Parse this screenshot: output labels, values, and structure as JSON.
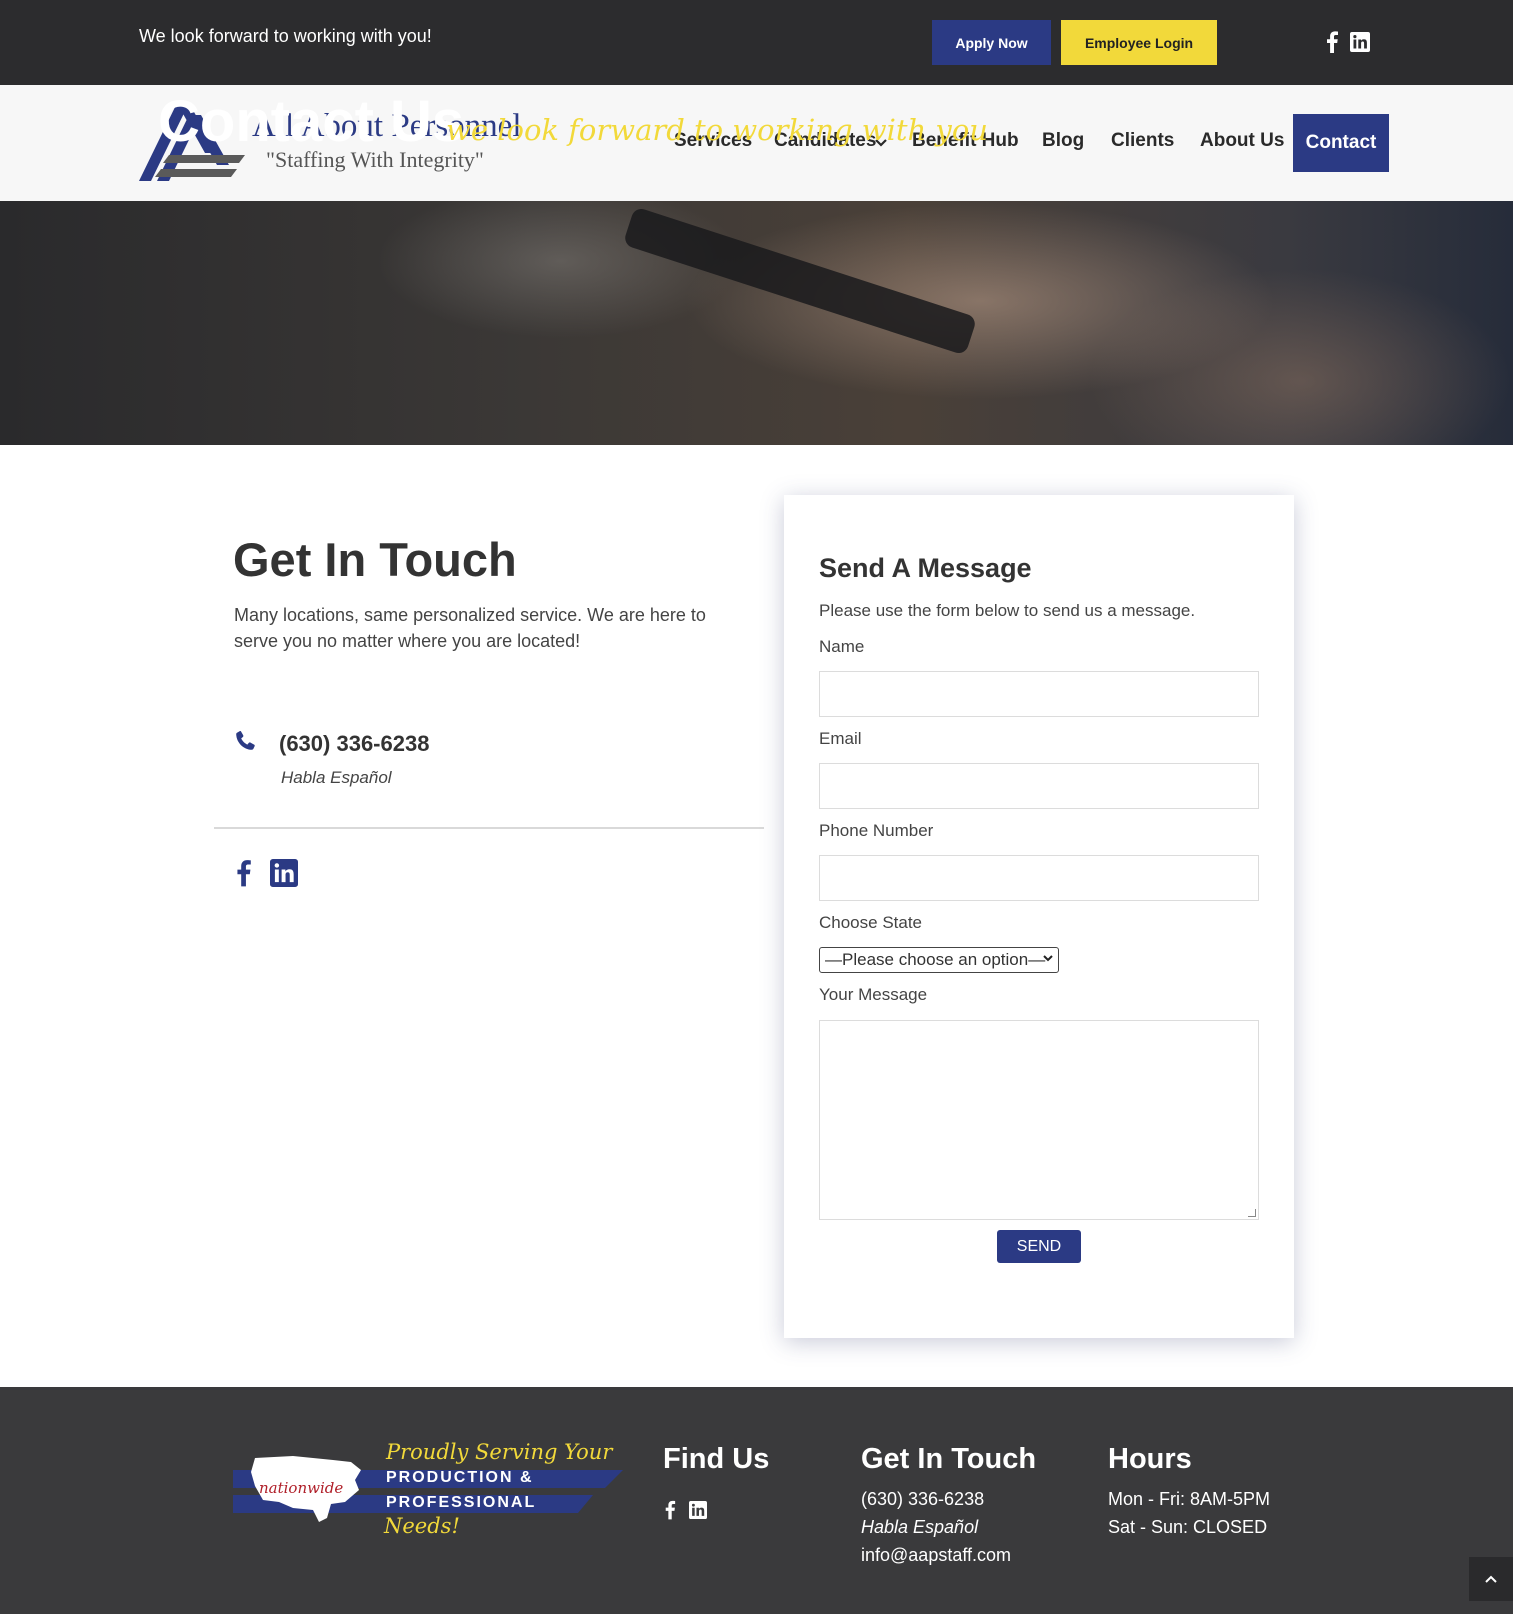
{
  "topbar": {
    "message": "We look forward to working with you!",
    "apply_label": "Apply Now",
    "login_label": "Employee Login",
    "social_icons": [
      "facebook-icon",
      "linkedin-icon"
    ]
  },
  "header": {
    "logo_title": "All About Personnel",
    "logo_tagline": "\"Staffing With Integrity\"",
    "nav": {
      "services": "Services",
      "candidates": "Candidates",
      "benefit_hub": "Benefit Hub",
      "blog": "Blog",
      "clients": "Clients",
      "about_us": "About Us",
      "contact": "Contact"
    }
  },
  "hero": {
    "title": "Contact Us",
    "subtitle": "we look forward to working with you"
  },
  "get_in_touch": {
    "title": "Get In Touch",
    "description": "Many locations, same personalized service. We are here to serve you no matter where you are located!",
    "phone": "(630) 336-6238",
    "language_note": "Habla Español"
  },
  "form": {
    "title": "Send A Message",
    "intro": "Please use the form below to send us a message.",
    "name_label": "Name",
    "email_label": "Email",
    "phone_label": "Phone Number",
    "state_label": "Choose State",
    "state_selected": "—Please choose an option—",
    "message_label": "Your Message",
    "send_label": "SEND"
  },
  "footer": {
    "badge": {
      "line1": "Proudly Serving Your",
      "line2": "PRODUCTION &",
      "line3": "PROFESSIONAL",
      "line4": "Needs!",
      "map_label": "nationwide"
    },
    "find_us_title": "Find Us",
    "get_in_touch_title": "Get In Touch",
    "phone": "(630) 336-6238",
    "language_note": "Habla Español",
    "email": "info@aapstaff.com",
    "hours_title": "Hours",
    "hours_weekday": "Mon - Fri: 8AM-5PM",
    "hours_weekend": "Sat - Sun: CLOSED"
  },
  "colors": {
    "brand_blue": "#2b3a84",
    "accent_yellow": "#f2d93a",
    "dark_bar": "#2c2c2e",
    "footer_bg": "#3a3a3c"
  }
}
